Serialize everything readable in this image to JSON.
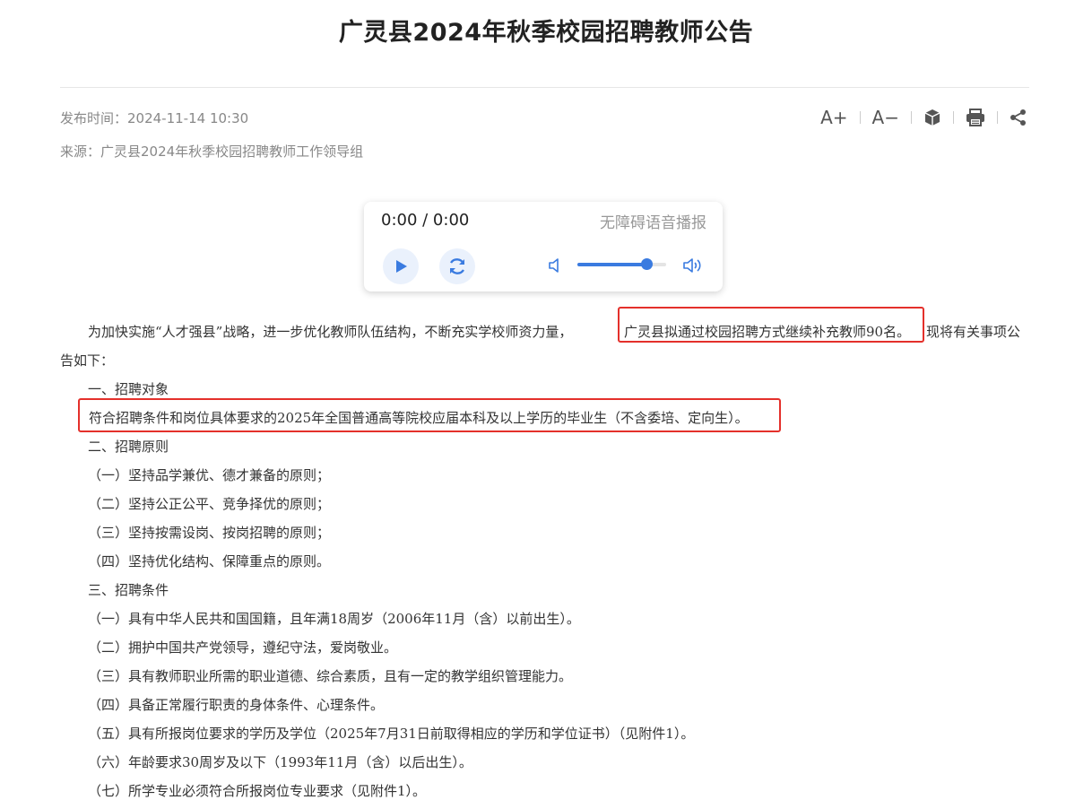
{
  "article": {
    "title": "广灵县2024年秋季校园招聘教师公告",
    "publish_time": "发布时间：2024-11-14 10:30",
    "source": "来源：广灵县2024年秋季校园招聘教师工作领导组"
  },
  "toolbar": {
    "font_increase": "A+",
    "font_decrease": "A−",
    "icons": [
      "cube-icon",
      "print-icon",
      "share-icon"
    ]
  },
  "player": {
    "time": "0:00 / 0:00",
    "label": "无障碍语音播报",
    "volume_level": 0.78,
    "accent_color": "#3a7be0"
  },
  "body": {
    "intro_a": "为加快实施“人才强县”战略，进一步优化教师队伍结构，不断充实学校师资力量，",
    "intro_highlight": "广灵县拟通过校园招聘方式继续补充教师90名。",
    "intro_b": "现将有关事项公",
    "intro_c": "告如下：",
    "sec1": "一、招聘对象",
    "sec1_text": "符合招聘条件和岗位具体要求的2025年全国普通高等院校应届本科及以上学历的毕业生（不含委培、定向生）。",
    "sec2": "二、招聘原则",
    "principles": [
      "（一）坚持品学兼优、德才兼备的原则；",
      "（二）坚持公正公平、竞争择优的原则；",
      "（三）坚持按需设岗、按岗招聘的原则；",
      "（四）坚持优化结构、保障重点的原则。"
    ],
    "sec3": "三、招聘条件",
    "conditions": [
      "（一）具有中华人民共和国国籍，且年满18周岁（2006年11月（含）以前出生）。",
      "（二）拥护中国共产党领导，遵纪守法，爱岗敬业。",
      "（三）具有教师职业所需的职业道德、综合素质，且有一定的教学组织管理能力。",
      "（四）具备正常履行职责的身体条件、心理条件。",
      "（五）具有所报岗位要求的学历及学位（2025年7月31日前取得相应的学历和学位证书）（见附件1）。",
      "（六）年龄要求30周岁及以下（1993年11月（含）以后出生）。",
      "（七）所学专业必须符合所报岗位专业要求（见附件1）。"
    ],
    "highlight_color": "#e4302b"
  }
}
